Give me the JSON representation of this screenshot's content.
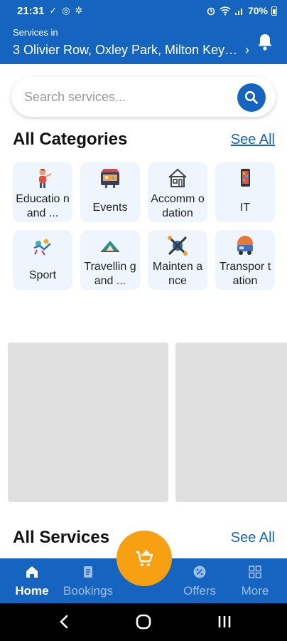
{
  "status_bar": {
    "time": "21:31",
    "left_icons": [
      "check-icon",
      "location-icon",
      "settings-icon"
    ],
    "battery": "70%"
  },
  "header": {
    "label": "Services in",
    "address": "3 Olivier Row, Oxley Park, Milton Keyn...",
    "chevron": "›"
  },
  "search": {
    "placeholder": "Search services..."
  },
  "categories_section": {
    "title": "All Categories",
    "see_all": "See All",
    "items": [
      {
        "label": "Educatio n and ...",
        "icon": "education-icon"
      },
      {
        "label": "Events",
        "icon": "events-icon"
      },
      {
        "label": "Accomm odation",
        "icon": "accommodation-icon"
      },
      {
        "label": "IT",
        "icon": "it-icon"
      },
      {
        "label": "Sport",
        "icon": "sport-icon"
      },
      {
        "label": "Travellin g and ...",
        "icon": "travelling-icon"
      },
      {
        "label": "Mainten ance",
        "icon": "maintenance-icon"
      },
      {
        "label": "Transpor tation",
        "icon": "transportation-icon"
      }
    ]
  },
  "services_section": {
    "title": "All Services",
    "see_all": "See All"
  },
  "bottom_nav": {
    "items": [
      {
        "label": "Home",
        "icon": "home-icon",
        "active": true
      },
      {
        "label": "Bookings",
        "icon": "bookings-icon",
        "active": false
      },
      {
        "label": "Offers",
        "icon": "offers-icon",
        "active": false
      },
      {
        "label": "More",
        "icon": "grid-icon",
        "active": false
      }
    ],
    "fab_icon": "cart-add-icon"
  },
  "colors": {
    "primary": "#1565c0",
    "accent": "#f7a012",
    "card_bg": "#eef5fc",
    "placeholder_bg": "#e0e0e0"
  }
}
